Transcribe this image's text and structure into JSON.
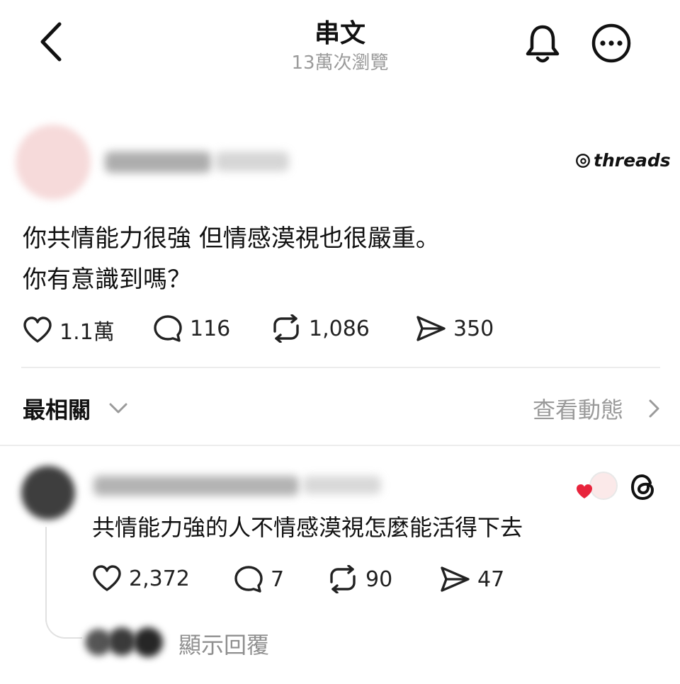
{
  "header": {
    "title": "串文",
    "views": "13萬次瀏覽"
  },
  "post": {
    "brand": "threads",
    "lines": [
      "你共情能力很強 但情感漠視也很嚴重。",
      "你有意識到嗎？"
    ],
    "stats": {
      "likes": "1.1萬",
      "comments": "116",
      "reposts": "1,086",
      "shares": "350"
    }
  },
  "sort": {
    "label": "最相關",
    "view_activity": "查看動態"
  },
  "reply": {
    "text": "共情能力強的人不情感漠視怎麼能活得下去",
    "stats": {
      "likes": "2,372",
      "comments": "7",
      "reposts": "90",
      "shares": "47"
    },
    "show_replies": "顯示回覆"
  },
  "colors": {
    "heart_badge": "#e8243c",
    "muted_text": "#9a9a9a",
    "divider": "#ececec"
  },
  "icons": [
    "back-arrow-icon",
    "bell-icon",
    "more-icon",
    "threads-logo-icon",
    "heart-icon",
    "comment-icon",
    "repost-icon",
    "share-icon",
    "chevron-down-icon",
    "chevron-right-icon"
  ]
}
